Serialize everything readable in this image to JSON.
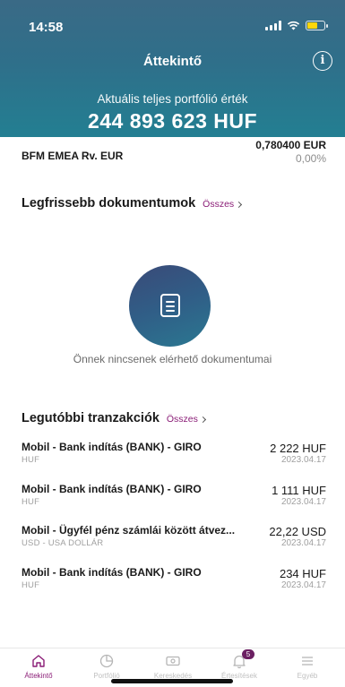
{
  "status_bar": {
    "time": "14:58"
  },
  "header": {
    "title": "Áttekintő",
    "portfolio_label": "Aktuális teljes portfólió érték",
    "portfolio_value": "244 893 623 HUF"
  },
  "fund": {
    "name": "BFM EMEA Rv. EUR",
    "price": "0,780400 EUR",
    "change": "0,00%"
  },
  "documents": {
    "title": "Legfrissebb dokumentumok",
    "link": "Összes",
    "empty_text": "Önnek nincsenek elérhető dokumentumai"
  },
  "transactions": {
    "title": "Legutóbbi tranzakciók",
    "link": "Összes",
    "items": [
      {
        "title": "Mobil - Bank indítás (BANK) - GIRO",
        "sub": "HUF",
        "amount": "2 222 HUF",
        "date": "2023.04.17"
      },
      {
        "title": "Mobil - Bank indítás (BANK) - GIRO",
        "sub": "HUF",
        "amount": "1 111 HUF",
        "date": "2023.04.17"
      },
      {
        "title": "Mobil - Ügyfél pénz számlái között átvez...",
        "sub": "USD - USA DOLLÁR",
        "amount": "22,22 USD",
        "date": "2023.04.17"
      },
      {
        "title": "Mobil - Bank indítás (BANK) - GIRO",
        "sub": "HUF",
        "amount": "234 HUF",
        "date": "2023.04.17"
      }
    ]
  },
  "tabbar": {
    "tabs": [
      {
        "label": "Áttekintő",
        "icon": "home-icon"
      },
      {
        "label": "Portfólió",
        "icon": "pie-chart-icon"
      },
      {
        "label": "Kereskedés",
        "icon": "banknote-icon"
      },
      {
        "label": "Értesítések",
        "icon": "bell-icon",
        "badge": "5"
      },
      {
        "label": "Egyéb",
        "icon": "menu-icon"
      }
    ]
  },
  "colors": {
    "accent": "#8a1c76",
    "header_start": "#3a6a86",
    "header_end": "#237f92",
    "badge": "#6b1f62"
  }
}
